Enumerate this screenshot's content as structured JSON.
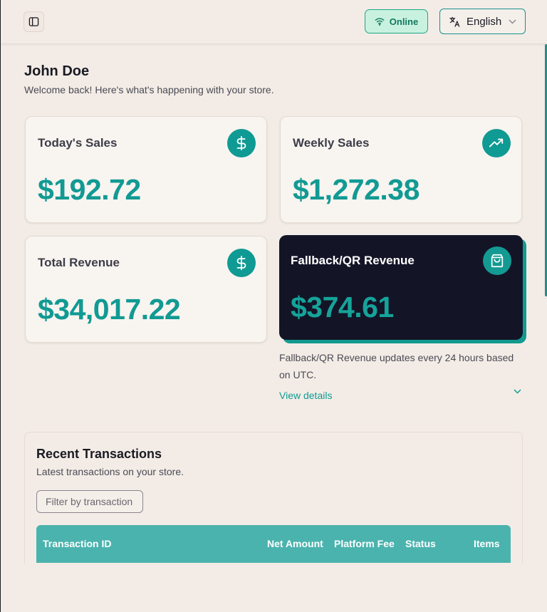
{
  "header": {
    "online_label": "Online",
    "language": "English"
  },
  "page": {
    "title": "John Doe",
    "subtitle": "Welcome back! Here's what's happening with your store."
  },
  "cards": {
    "today": {
      "label": "Today's Sales",
      "value": "$192.72"
    },
    "weekly": {
      "label": "Weekly Sales",
      "value": "$1,272.38"
    },
    "total": {
      "label": "Total Revenue",
      "value": "$34,017.22"
    },
    "fallback": {
      "label": "Fallback/QR Revenue",
      "value": "$374.61"
    }
  },
  "fallback_note": "Fallback/QR Revenue updates every 24 hours based on UTC.",
  "view_details": "View details",
  "transactions": {
    "title": "Recent Transactions",
    "subtitle": "Latest transactions on your store.",
    "filter_placeholder": "Filter by transaction",
    "columns": [
      "Transaction ID",
      "Net Amount",
      "Platform Fee",
      "Status",
      "Items"
    ]
  },
  "colors": {
    "accent": "#119a93",
    "dark_card": "#131527",
    "table_header": "#4bb3ae",
    "online_bg": "#c8f2df"
  }
}
